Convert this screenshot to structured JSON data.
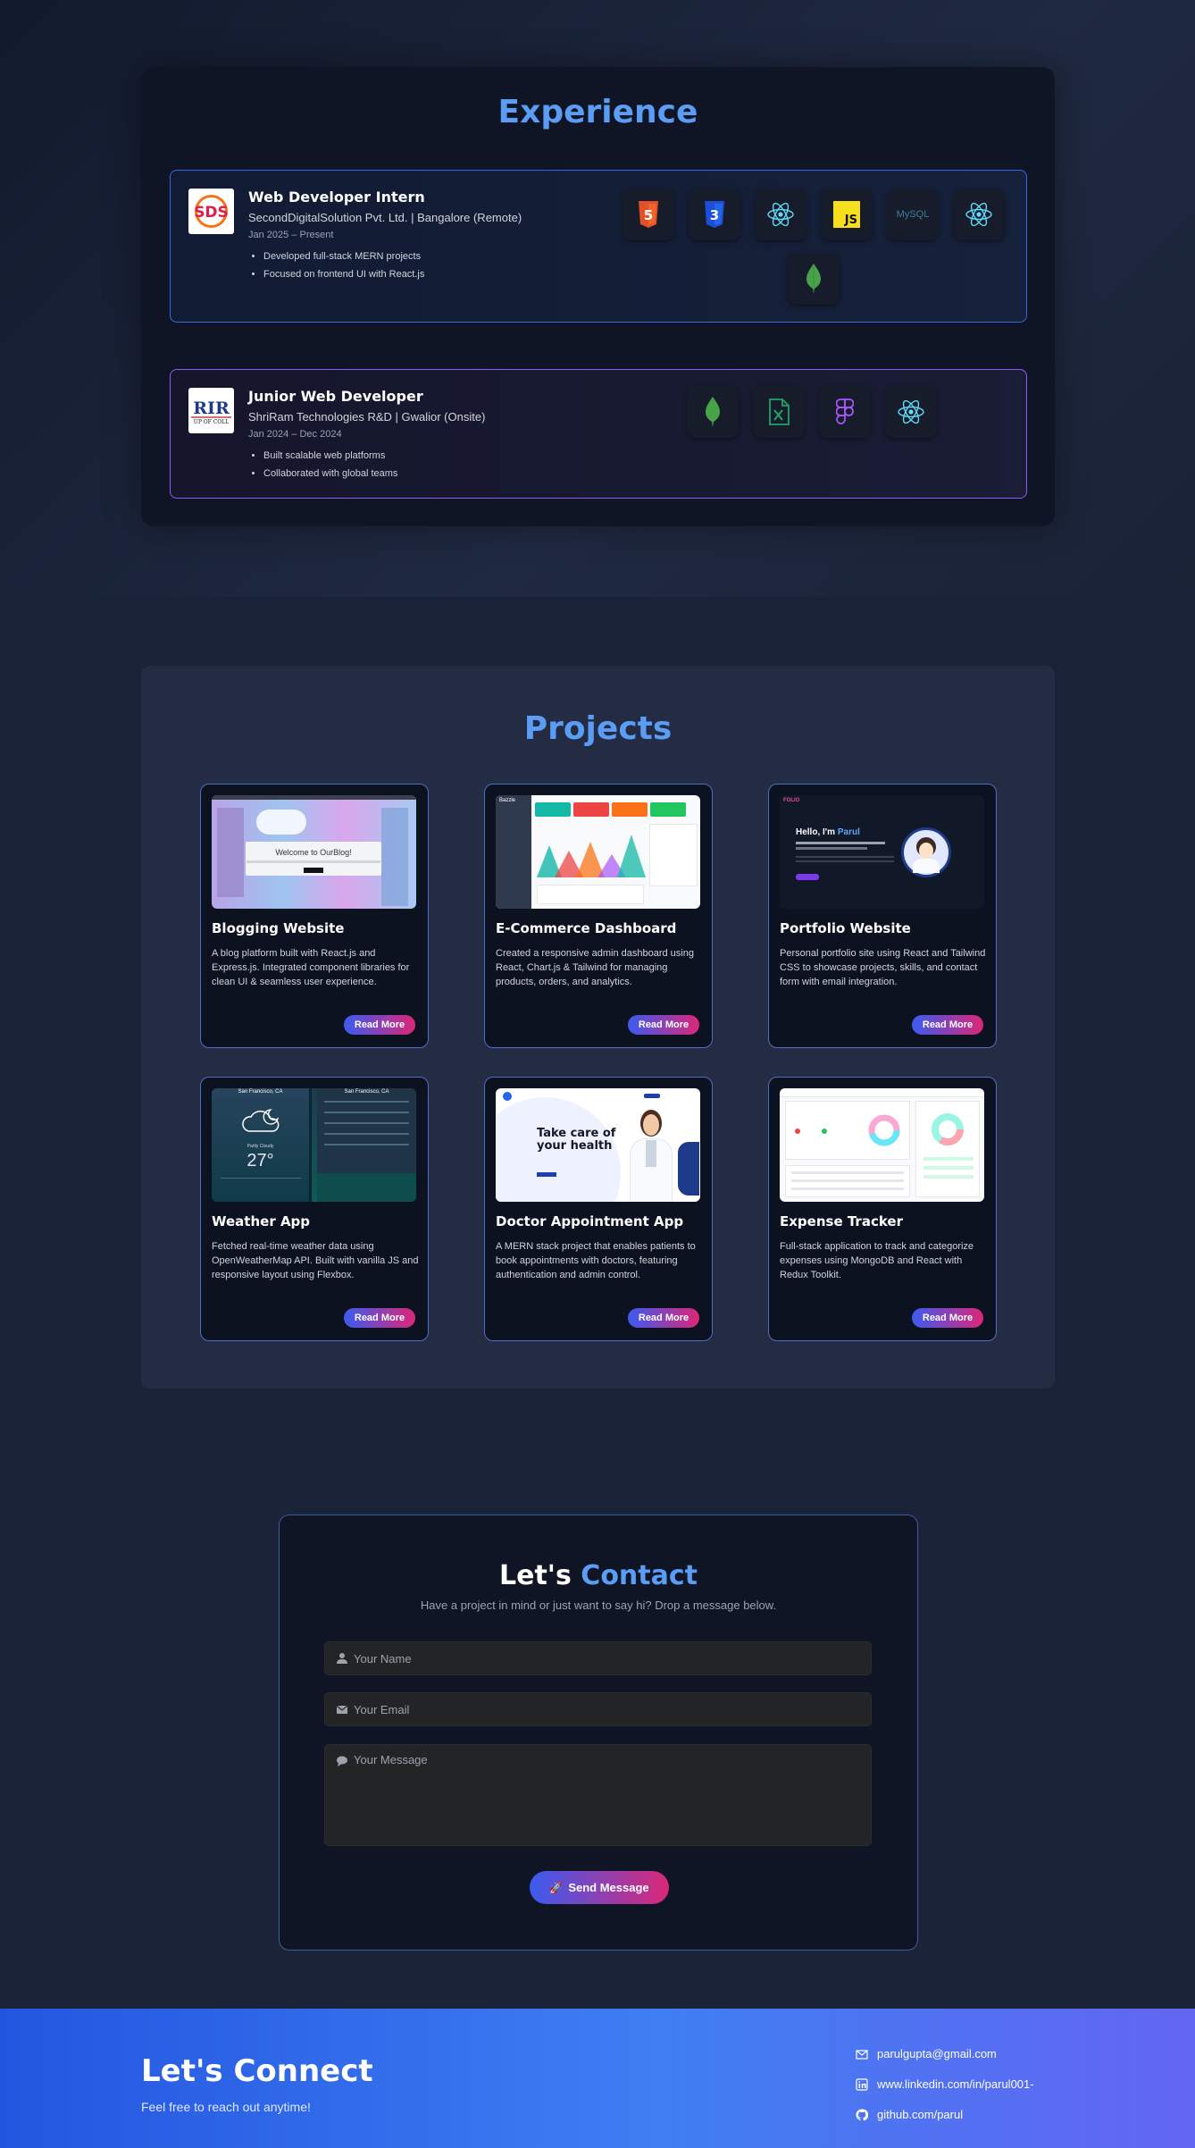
{
  "experience": {
    "title": "Experience",
    "jobs": [
      {
        "logo": "SDS",
        "role": "Web Developer Intern",
        "company": "SecondDigitalSolution Pvt. Ltd. | Bangalore (Remote)",
        "dates": "Jan 2025 – Present",
        "bullets": [
          "Developed full-stack MERN projects",
          "Focused on frontend UI with React.js"
        ],
        "tech": [
          "html5-icon",
          "css3-icon",
          "react-icon",
          "javascript-icon",
          "mysql-icon",
          "react-icon",
          "mongodb-icon"
        ]
      },
      {
        "logo": "RIR",
        "logo_sub": "UP OF COLL",
        "role": "Junior Web Developer",
        "company": "ShriRam Technologies R&D | Gwalior (Onsite)",
        "dates": "Jan 2024 – Dec 2024",
        "bullets": [
          "Built scalable web platforms",
          "Collaborated with global teams"
        ],
        "tech": [
          "mongodb-icon",
          "excel-icon",
          "figma-icon",
          "react-icon"
        ]
      }
    ],
    "js_label": "JS",
    "mysql_label": "MySQL"
  },
  "projects": {
    "title": "Projects",
    "read_more": "Read More",
    "items": [
      {
        "name": "Blogging Website",
        "desc": "A blog platform built with React.js and Express.js. Integrated component libraries for clean UI & seamless user experience.",
        "thumb_text": "Welcome to OurBlog!"
      },
      {
        "name": "E-Commerce Dashboard",
        "desc": "Created a responsive admin dashboard using React, Chart.js & Tailwind for managing products, orders, and analytics.",
        "thumb_text": "Bazzle"
      },
      {
        "name": "Portfolio Website",
        "desc": "Personal portfolio site using React and Tailwind CSS to showcase projects, skills, and contact form with email integration.",
        "thumb_text": "Hello, I'm",
        "thumb_accent": "Parul",
        "thumb_brand": "FOLIO"
      },
      {
        "name": "Weather App",
        "desc": "Fetched real-time weather data using OpenWeatherMap API. Built with vanilla JS and responsive layout using Flexbox.",
        "thumb_text": "27°",
        "thumb_city": "San Francisco, CA",
        "thumb_cond": "Partly Cloudy"
      },
      {
        "name": "Doctor Appointment App",
        "desc": "A MERN stack project that enables patients to book appointments with doctors, featuring authentication and admin control.",
        "thumb_text": "Take care of your health"
      },
      {
        "name": "Expense Tracker",
        "desc": "Full-stack application to track and categorize expenses using MongoDB and React with Redux Toolkit.",
        "thumb_text": ""
      }
    ]
  },
  "contact": {
    "title_a": "Let's",
    "title_b": "Contact",
    "subtitle": "Have a project in mind or just want to say hi? Drop a message below.",
    "name_placeholder": "Your Name",
    "email_placeholder": "Your Email",
    "message_placeholder": "Your Message",
    "send_label": "Send Message",
    "send_icon": "🚀"
  },
  "footer": {
    "title": "Let's Connect",
    "subtitle": "Feel free to reach out anytime!",
    "email": "parulgupta@gmail.com",
    "linkedin": "www.linkedin.com/in/parul001-",
    "github": "github.com/parul"
  },
  "colors": {
    "accent_blue": "#5b9cf5",
    "button_gradient_start": "#3b5bf0",
    "button_gradient_end": "#db2777",
    "footer_gradient_start": "#2356e0",
    "footer_gradient_end": "#6366f1"
  }
}
